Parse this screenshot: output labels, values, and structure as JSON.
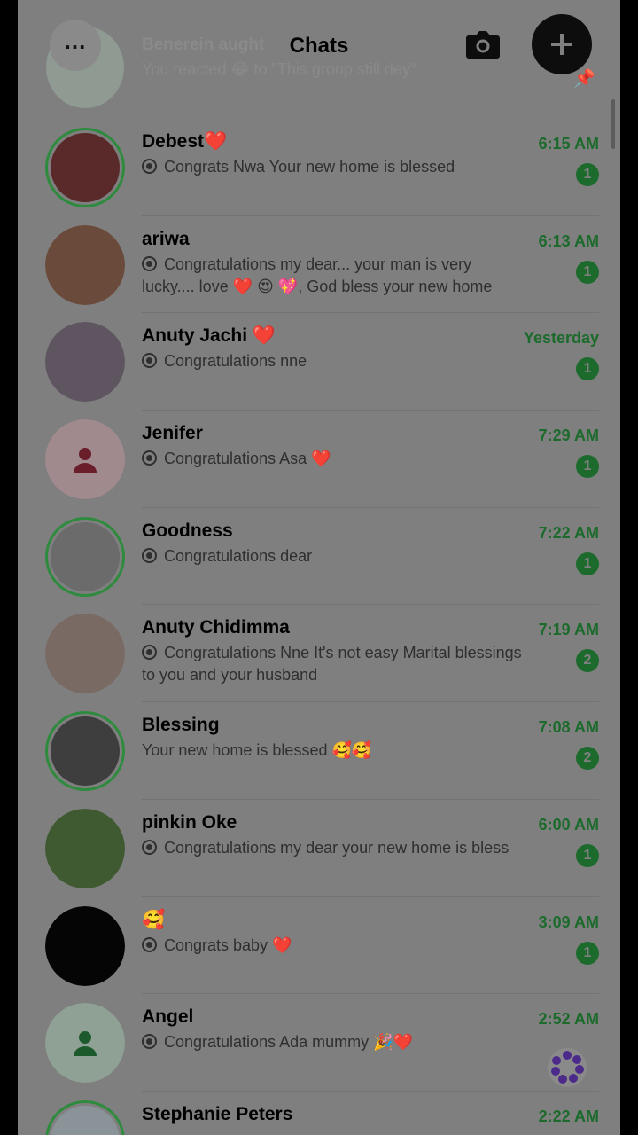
{
  "header": {
    "title": "Chats",
    "menu_icon": "more-horizontal-icon",
    "camera_icon": "camera-icon",
    "new_chat_icon": "plus-icon"
  },
  "ghost_row": {
    "name": "Benerein aught",
    "message": "You reacted 😂 to \"This group still dey\""
  },
  "chats": [
    {
      "name": "Debest❤️",
      "message": "Congrats Nwa Your new home is blessed",
      "time": "6:15 AM",
      "unread": "1",
      "ring": true,
      "status_icon": true,
      "avatar_color": "#5a2a2a"
    },
    {
      "name": "ariwa",
      "message": "Congratulations my dear... your man is very lucky.... love ❤️ 😍 💖, God bless your new home",
      "time": "6:13 AM",
      "unread": "1",
      "ring": false,
      "status_icon": true,
      "avatar_color": "#6a4a3a"
    },
    {
      "name": "Anuty Jachi ❤️",
      "message": "Congratulations nne",
      "time": "Yesterday",
      "unread": "1",
      "ring": false,
      "status_icon": true,
      "avatar_color": "#5e5560"
    },
    {
      "name": "Jenifer",
      "message": "Congratulations Asa ❤️",
      "time": "7:29 AM",
      "unread": "1",
      "ring": false,
      "status_icon": true,
      "avatar_color": "#a08a8e",
      "placeholder": true
    },
    {
      "name": "Goodness",
      "message": "Congratulations dear",
      "time": "7:22 AM",
      "unread": "1",
      "ring": true,
      "status_icon": true,
      "avatar_color": "#6b6b6b"
    },
    {
      "name": "Anuty Chidimma",
      "message": "Congratulations Nne  It's not easy  Marital blessings to you and your husband",
      "time": "7:19 AM",
      "unread": "2",
      "ring": false,
      "status_icon": true,
      "avatar_color": "#7a6a64"
    },
    {
      "name": "Blessing",
      "message": "Your new home is blessed 🥰🥰",
      "time": "7:08 AM",
      "unread": "2",
      "ring": true,
      "status_icon": false,
      "avatar_color": "#3e3e3e"
    },
    {
      "name": "pinkin Oke",
      "message": "Congratulations my dear your new home is  bless",
      "time": "6:00 AM",
      "unread": "1",
      "ring": false,
      "status_icon": true,
      "avatar_color": "#3f5a30"
    },
    {
      "name": "🥰",
      "message": "Congrats baby ❤️",
      "time": "3:09 AM",
      "unread": "1",
      "ring": false,
      "status_icon": true,
      "avatar_color": "#050505"
    },
    {
      "name": "Angel",
      "message": "Congratulations Ada mummy 🎉❤️",
      "time": "2:52 AM",
      "unread": "",
      "ring": false,
      "status_icon": true,
      "avatar_color": "#8fa094",
      "placeholder": true
    },
    {
      "name": "Stephanie Peters",
      "message": "",
      "time": "2:22 AM",
      "unread": "",
      "ring": true,
      "status_icon": false,
      "avatar_color": "#8a9498"
    }
  ],
  "colors": {
    "accent": "#1c6b2c",
    "overlay_bg": "#7f7f7f"
  },
  "fab_icon": "meta-ai-icon"
}
